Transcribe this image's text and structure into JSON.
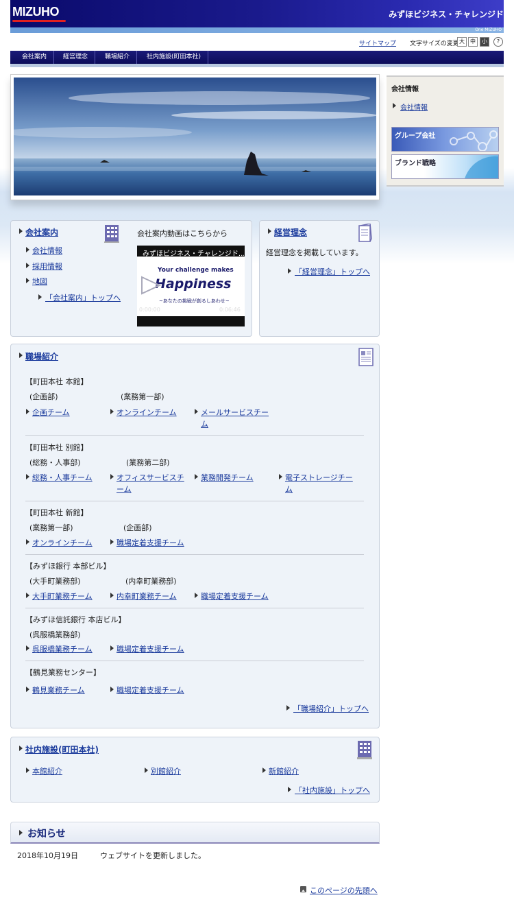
{
  "header": {
    "logo": "MIZUHO",
    "brand_name": "みずほビジネス・チャレンジド",
    "sub_brand": "One MIZUHO"
  },
  "utility": {
    "sitemap": "サイトマップ",
    "font_size_label": "文字サイズの変更",
    "font_large": "大",
    "font_medium": "中",
    "font_small": "小",
    "help": "?"
  },
  "nav": {
    "items": [
      {
        "label": "会社案内"
      },
      {
        "label": "経営理念"
      },
      {
        "label": "職場紹介"
      },
      {
        "label": "社内施設(町田本社)"
      }
    ]
  },
  "sidebar": {
    "info_title": "会社情報",
    "info_link": "会社情報",
    "banner_group": "グループ会社",
    "banner_brand": "ブランド戦略"
  },
  "company": {
    "title": "会社案内",
    "links": [
      "会社情報",
      "採用情報",
      "地図"
    ],
    "top_link": "「会社案内」トップへ",
    "video_caption": "会社案内動画はこちらから",
    "video_title": "みずほビジネス・チャレンジド...",
    "video_text1": "Your challenge makes",
    "video_text2": "Happiness",
    "video_text3": "~あなたの挑戦が創るしあわせ~",
    "video_time_current": "0:00:00",
    "video_time_total": "0:06:46"
  },
  "philosophy": {
    "title": "経営理念",
    "desc": "経営理念を掲載しています。",
    "top_link": "「経営理念」トップへ"
  },
  "workplace": {
    "title": "職場紹介",
    "groups": [
      {
        "heading": "【町田本社 本館】",
        "dept1": "(企画部)",
        "dept2": "(業務第一部)",
        "links": [
          "企画チーム",
          "オンラインチーム",
          "メールサービスチーム"
        ]
      },
      {
        "heading": "【町田本社 別館】",
        "dept1": "(総務・人事部)",
        "dept2": "(業務第二部)",
        "links": [
          "総務・人事チーム",
          "オフィスサービスチーム",
          "業務開発チーム",
          "電子ストレージチーム"
        ]
      },
      {
        "heading": "【町田本社 新館】",
        "dept1": "(業務第一部)",
        "dept2": "(企画部)",
        "links": [
          "オンラインチーム",
          "職場定着支援チーム"
        ]
      },
      {
        "heading": "【みずほ銀行 本部ビル】",
        "dept1": "(大手町業務部)",
        "dept2": "(内幸町業務部)",
        "links": [
          "大手町業務チーム",
          "内幸町業務チーム",
          "職場定着支援チーム"
        ]
      },
      {
        "heading": "【みずほ信託銀行 本店ビル】",
        "dept1": "(呉服橋業務部)",
        "links": [
          "呉服橋業務チーム",
          "職場定着支援チーム"
        ]
      },
      {
        "heading": "【鶴見業務センター】",
        "links": [
          "鶴見業務チーム",
          "職場定着支援チーム"
        ]
      }
    ],
    "top_link": "「職場紹介」トップへ"
  },
  "facility": {
    "title": "社内施設(町田本社)",
    "links": [
      "本館紹介",
      "別館紹介",
      "新館紹介"
    ],
    "top_link": "「社内施設」トップへ"
  },
  "news": {
    "title": "お知らせ",
    "items": [
      {
        "date": "2018年10月19日",
        "text": "ウェブサイトを更新しました。"
      }
    ]
  },
  "footer": {
    "page_top": "このページの先頭へ"
  }
}
